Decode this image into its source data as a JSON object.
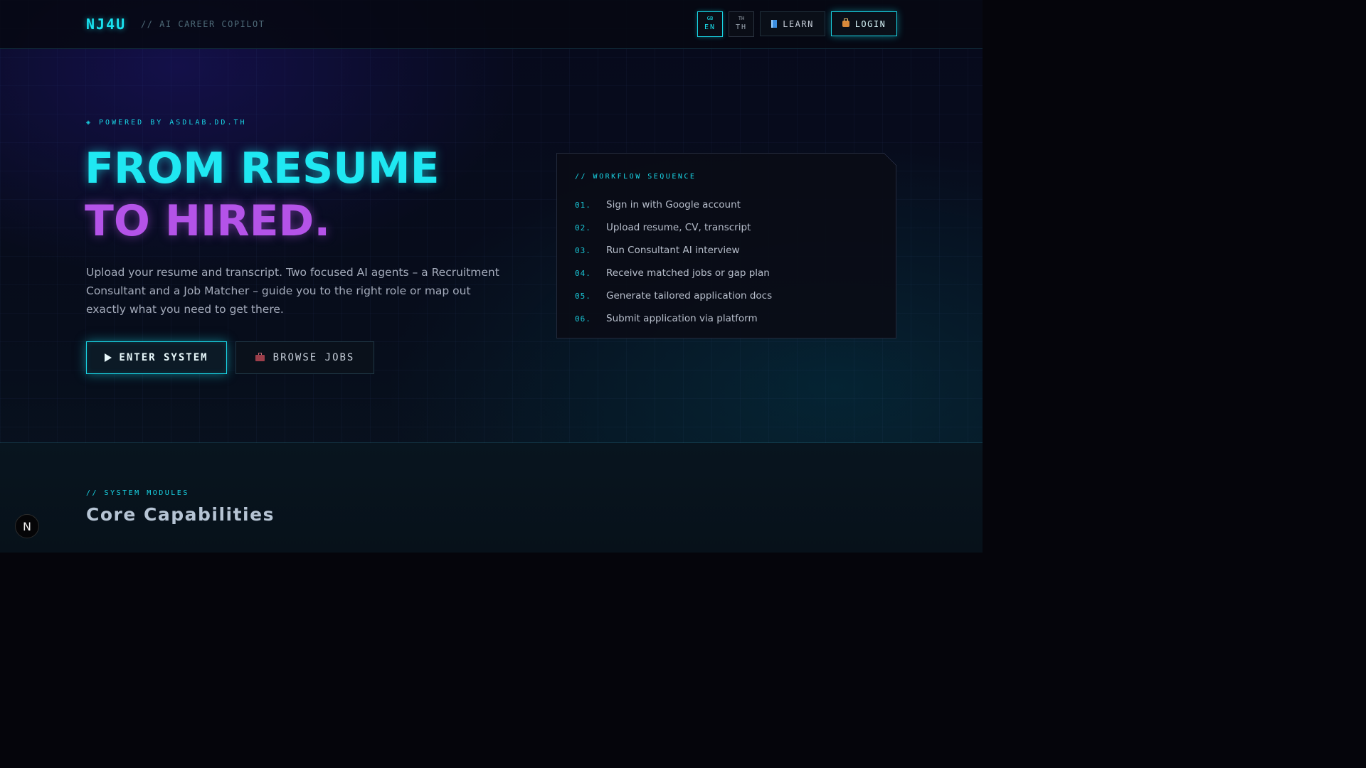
{
  "header": {
    "logo": "NJ4U",
    "tagline": "// AI CAREER COPILOT",
    "languages": [
      {
        "code": "GB",
        "label": "EN",
        "active": true
      },
      {
        "code": "TH",
        "label": "TH",
        "active": false
      }
    ],
    "learn_label": "LEARN",
    "login_label": "LOGIN"
  },
  "hero": {
    "powered_by": "◈ POWERED BY ASDLAB.DD.TH",
    "headline_line1": "FROM RESUME",
    "headline_line2": "TO HIRED.",
    "description": "Upload your resume and transcript. Two focused AI agents – a Recruitment Consultant and a Job Matcher – guide you to the right role or map out exactly what you need to get there.",
    "primary_button": "ENTER SYSTEM",
    "secondary_button": "BROWSE JOBS"
  },
  "workflow": {
    "title": "// WORKFLOW SEQUENCE",
    "steps": [
      {
        "num": "01.",
        "text": "Sign in with Google account"
      },
      {
        "num": "02.",
        "text": "Upload resume, CV, transcript"
      },
      {
        "num": "03.",
        "text": "Run Consultant AI interview"
      },
      {
        "num": "04.",
        "text": "Receive matched jobs or gap plan"
      },
      {
        "num": "05.",
        "text": "Generate tailored application docs"
      },
      {
        "num": "06.",
        "text": "Submit application via platform"
      }
    ]
  },
  "capabilities": {
    "label": "// SYSTEM MODULES",
    "title": "Core Capabilities"
  },
  "badge": {
    "label": "N"
  },
  "colors": {
    "accent_cyan": "#19e3f0",
    "accent_purple": "#b453e8",
    "background": "#05050b"
  }
}
